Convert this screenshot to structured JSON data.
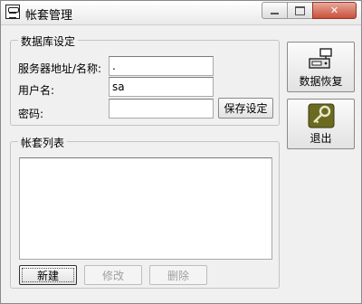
{
  "window": {
    "title": "帐套管理"
  },
  "db_group": {
    "legend": "数据库设定",
    "server_label": "服务器地址/名称:",
    "server_value": ".",
    "user_label": "用户名:",
    "user_value": "sa",
    "password_label": "密码:",
    "password_value": "",
    "save_button": "保存设定"
  },
  "side_buttons": {
    "restore_label": "数据恢复",
    "exit_label": "退出"
  },
  "list_group": {
    "legend": "帐套列表",
    "items": []
  },
  "bottom_buttons": {
    "new_label": "新建",
    "edit_label": "修改",
    "delete_label": "删除"
  },
  "icons": {
    "app": "account-book-icon",
    "restore": "database-restore-icon",
    "exit": "key-icon"
  }
}
